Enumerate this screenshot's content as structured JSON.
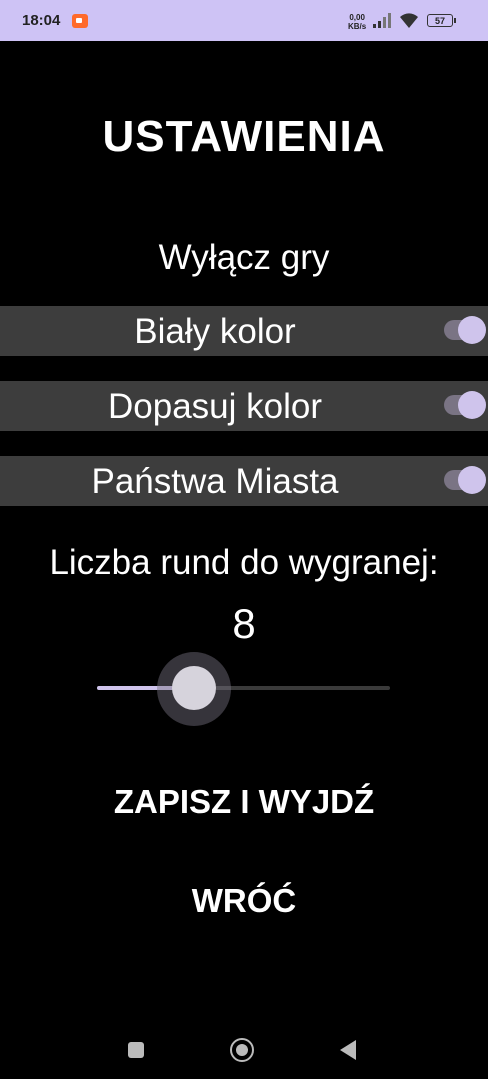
{
  "status_bar": {
    "time": "18:04",
    "net_speed_value": "0,00",
    "net_speed_unit": "KB/s",
    "battery": "57"
  },
  "title": "USTAWIENIA",
  "disable_games_label": "Wyłącz gry",
  "toggles": [
    {
      "label": "Biały kolor",
      "on": true
    },
    {
      "label": "Dopasuj kolor",
      "on": true
    },
    {
      "label": "Państwa Miasta",
      "on": true
    }
  ],
  "rounds": {
    "label": "Liczba rund do wygranej:",
    "value": "8",
    "slider_fraction": 0.33
  },
  "buttons": {
    "save_exit": "ZAPISZ I WYJDŹ",
    "back": "WRÓĆ"
  },
  "colors": {
    "status_bar": "#cec3f5",
    "accent": "#cfc4ec",
    "row_bg": "#3d3d3d",
    "background": "#000000"
  }
}
